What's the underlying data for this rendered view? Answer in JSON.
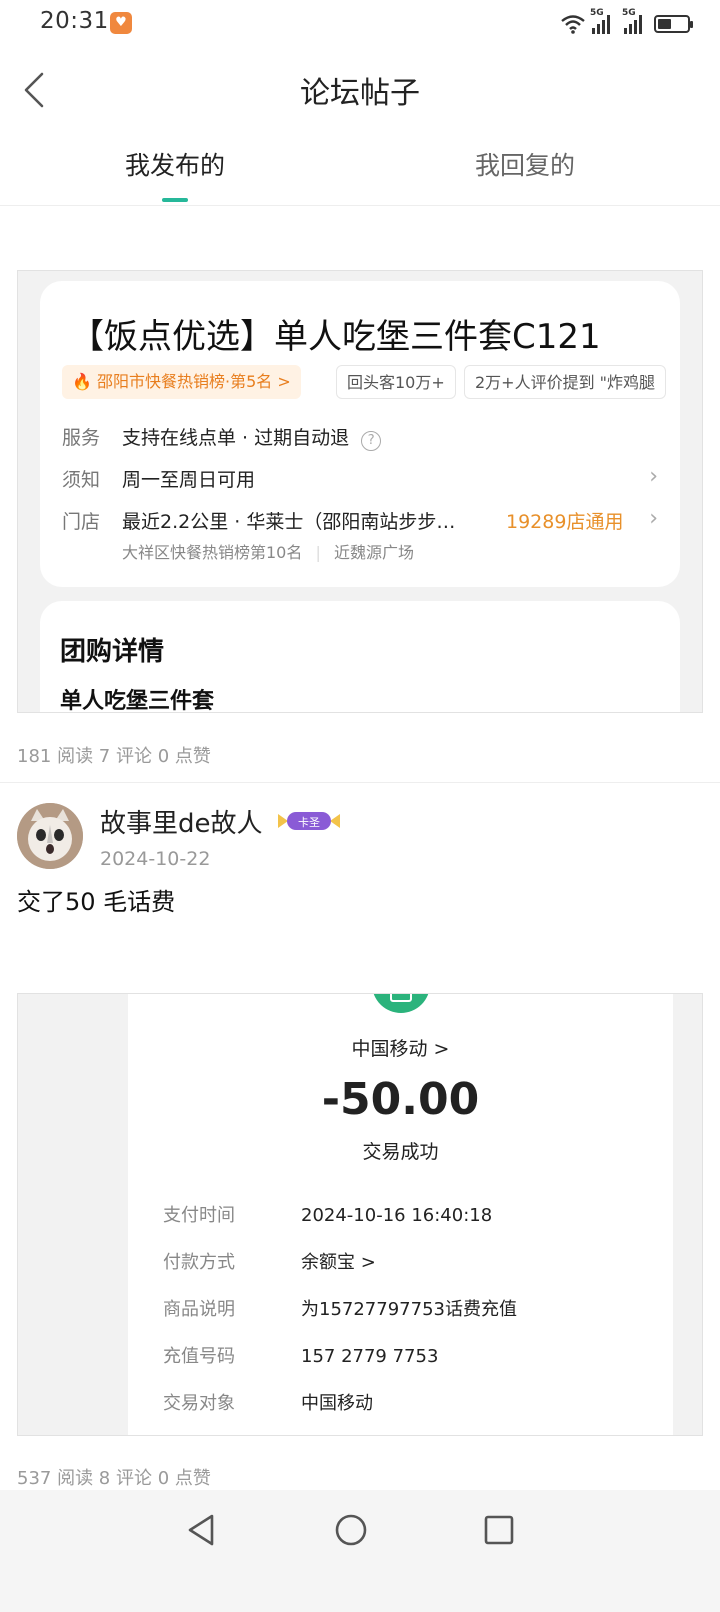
{
  "status_bar": {
    "time": "20:31",
    "battery_level": 0.45,
    "network": "5G"
  },
  "header": {
    "title": "论坛帖子"
  },
  "tabs": [
    {
      "label": "我发布的",
      "active": true
    },
    {
      "label": "我回复的",
      "active": false
    }
  ],
  "posts": [
    {
      "deal": {
        "title": "【饭点优选】单人吃堡三件套C121",
        "chips": [
          "邵阳市快餐热销榜·第5名 >",
          "回头客10万+",
          "2万+人评价提到 \"炸鸡腿"
        ],
        "service_label": "服务",
        "service_value": "支持在线点单 · 过期自动退",
        "notice_label": "须知",
        "notice_value": "周一至周日可用",
        "store_label": "门店",
        "store_value": "最近2.2公里 · 华莱士（邵阳南站步步…",
        "store_count": "19289店通用",
        "store_sub": "大祥区快餐热销榜第10名",
        "store_sub2": "近魏源广场",
        "detail_heading": "团购详情",
        "detail_sub": "单人吃堡三件套"
      },
      "stats": "181 阅读 7 评论 0 点赞"
    },
    {
      "author": "故事里de故人",
      "badge_text": "卡圣",
      "date": "2024-10-22",
      "text": "交了50 毛话费",
      "receipt": {
        "merchant": "中国移动 >",
        "amount": "-50.00",
        "status": "交易成功",
        "rows": [
          {
            "k": "支付时间",
            "v": "2024-10-16 16:40:18"
          },
          {
            "k": "付款方式",
            "v": "余额宝 >"
          },
          {
            "k": "商品说明",
            "v": "为15727797753话费充值"
          },
          {
            "k": "充值号码",
            "v": "157 2779 7753"
          },
          {
            "k": "交易对象",
            "v": "中国移动"
          }
        ]
      },
      "stats": "537 阅读 8 评论 0 点赞"
    }
  ],
  "colors": {
    "accent": "#26b89a",
    "orange": "#e8902a"
  }
}
